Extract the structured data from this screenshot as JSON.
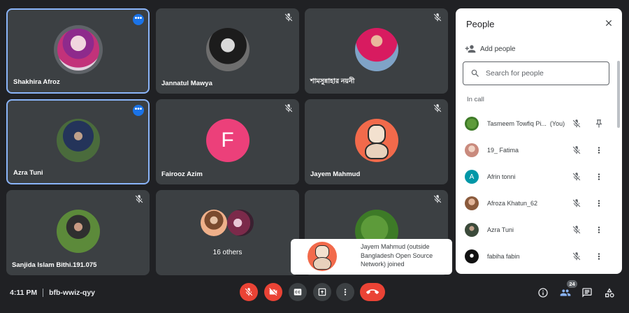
{
  "tiles": [
    {
      "name": "Shakhira Afroz"
    },
    {
      "name": "Jannatul Mawya"
    },
    {
      "name": "শামসুন্নাহার নয়নী"
    },
    {
      "name": "Azra Tuni"
    },
    {
      "name": "Fairooz Azim",
      "initial": "F"
    },
    {
      "name": "Jayem Mahmud"
    },
    {
      "name": "Sanjida Islam Bithi.191.075"
    },
    {
      "others_label": "16 others"
    },
    {
      "name": ""
    }
  ],
  "panel": {
    "title": "People",
    "add_people": "Add people",
    "search_placeholder": "Search for people",
    "in_call": "In call",
    "people": [
      {
        "name": "Tasmeem Towfiq Pi...",
        "suffix": "(You)"
      },
      {
        "name": "19_ Fatima"
      },
      {
        "name": "Afrin tonni",
        "initial": "A"
      },
      {
        "name": "Afroza Khatun_62"
      },
      {
        "name": "Azra Tuni"
      },
      {
        "name": "fabiha fabin"
      }
    ]
  },
  "toast": {
    "text": "Jayem Mahmud (outside Bangladesh Open Source Network) joined"
  },
  "meeting": {
    "time": "4:11 PM",
    "code": "bfb-wwiz-qyy"
  },
  "participants_count": "24",
  "more_symbol": "•••",
  "colors": {
    "accent": "#8ab4f8",
    "danger": "#ea4335",
    "tile": "#3c4043",
    "background": "#202124"
  }
}
